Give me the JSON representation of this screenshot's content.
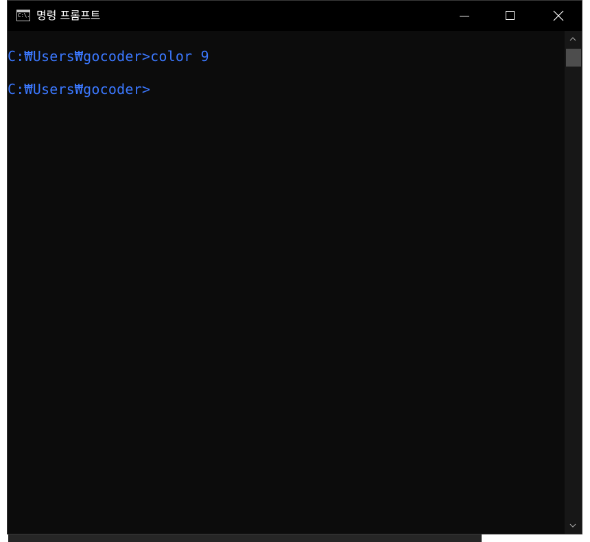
{
  "window": {
    "title": "명령 프롬프트",
    "icon": "cmd-icon",
    "icon_glyph": "C:\\."
  },
  "controls": {
    "minimize": "minimize-icon",
    "maximize": "maximize-icon",
    "close": "close-icon"
  },
  "console": {
    "lines": [
      "C:₩Users₩gocoder>color 9",
      "C:₩Users₩gocoder>"
    ],
    "text_color": "#3b78ff",
    "background_color": "#0c0c0c"
  }
}
